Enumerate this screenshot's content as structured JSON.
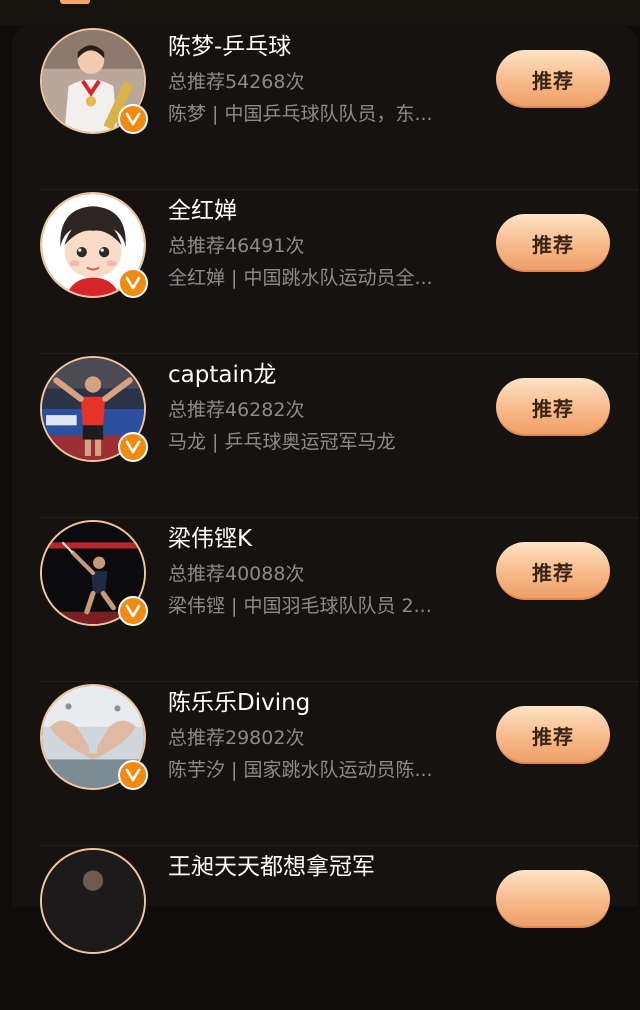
{
  "list": {
    "rows": [
      {
        "name": "陈梦-乒乓球",
        "count": "总推荐54268次",
        "desc": "陈梦 | 中国乒乓球队队员，东...",
        "button": "推荐",
        "avatar": "medalist-photo"
      },
      {
        "name": "全红婵",
        "count": "总推荐46491次",
        "desc": "全红婵 | 中国跳水队运动员全...",
        "button": "推荐",
        "avatar": "cartoon-avatar"
      },
      {
        "name": "captain龙",
        "count": "总推荐46282次",
        "desc": "马龙 | 乒乓球奥运冠军马龙",
        "button": "推荐",
        "avatar": "table-tennis-photo"
      },
      {
        "name": "梁伟铿K",
        "count": "总推荐40088次",
        "desc": "梁伟铿 | 中国羽毛球队队员 2...",
        "button": "推荐",
        "avatar": "badminton-photo"
      },
      {
        "name": "陈乐乐Diving",
        "count": "总推荐29802次",
        "desc": "陈芋汐 | 国家跳水队运动员陈...",
        "button": "推荐",
        "avatar": "heart-hands-photo"
      },
      {
        "name": "王昶天天都想拿冠军",
        "count": "",
        "desc": "",
        "button": "",
        "avatar": "partial-photo"
      }
    ]
  },
  "colors": {
    "background": "#0f0d0c",
    "card": "#161210",
    "button_gradient_top": "#fde3c4",
    "button_gradient_bottom": "#ef9d64",
    "verified_badge": "#f08a12",
    "secondary_text": "#8f8a85"
  },
  "icons": {
    "verified": "verified-v-icon"
  }
}
